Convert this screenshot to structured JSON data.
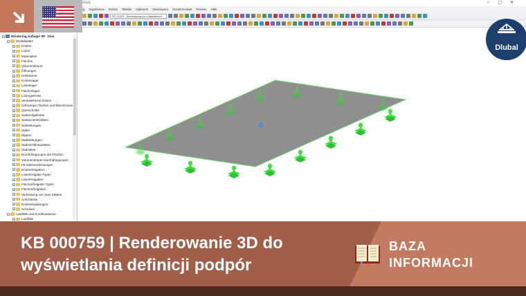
{
  "window": {
    "title": "Glas]"
  },
  "menu": [
    "ung",
    "Ergebnisse",
    "Extras",
    "Tabelle",
    "Optionen",
    "Developers",
    "Zusatzmodule",
    "Fenster",
    "Hilfe"
  ],
  "toolbar": {
    "module_combo": "RF-GLAS - Bemessung von Glasflächen"
  },
  "tree": {
    "root": "Rendering Auflager RF_Glas",
    "items": [
      {
        "label": "Modelldaten",
        "level": 1
      },
      {
        "label": "Knoten",
        "level": 2
      },
      {
        "label": "Linien",
        "level": 2
      },
      {
        "label": "Materialien",
        "level": 2
      },
      {
        "label": "Flächen",
        "level": 2
      },
      {
        "label": "Volumenkörper",
        "level": 2
      },
      {
        "label": "Öffnungen",
        "level": 2
      },
      {
        "label": "Hohlräume",
        "level": 2
      },
      {
        "label": "Knotenlager",
        "level": 2
      },
      {
        "label": "Linienlager",
        "level": 2
      },
      {
        "label": "Flächenlager",
        "level": 2
      },
      {
        "label": "Liniengelenke",
        "level": 2
      },
      {
        "label": "Veränderliche Dicken",
        "level": 2
      },
      {
        "label": "Orthotrope Flächen und Membranen",
        "level": 2
      },
      {
        "label": "Querschnitte",
        "level": 2
      },
      {
        "label": "Stabendgelenke",
        "level": 2
      },
      {
        "label": "Stabexzentrizitäten",
        "level": 2
      },
      {
        "label": "Stabteilungen",
        "level": 2
      },
      {
        "label": "Stäbe",
        "level": 2
      },
      {
        "label": "Rippen",
        "level": 2
      },
      {
        "label": "Stabbettungen",
        "level": 2
      },
      {
        "label": "Stabnichtlinearitäten",
        "level": 2
      },
      {
        "label": "Stabsätze",
        "level": 2
      },
      {
        "label": "Durchdringungen der Flächen",
        "level": 2
      },
      {
        "label": "Volumenkörper-Durchdringungen",
        "level": 2
      },
      {
        "label": "FE-Netzverdichtungen",
        "level": 2
      },
      {
        "label": "Knotenfreigaben",
        "level": 2
      },
      {
        "label": "Linienfreigabe-Typen",
        "level": 2
      },
      {
        "label": "Linienfreigaben",
        "level": 2
      },
      {
        "label": "Flächenfreigabe-Typen",
        "level": 2
      },
      {
        "label": "Flächenfreigaben",
        "level": 2
      },
      {
        "label": "Verbindung von zwei Stäben",
        "level": 2
      },
      {
        "label": "Anschlüsse",
        "level": 2
      },
      {
        "label": "Knotenkopplungen",
        "level": 2
      },
      {
        "label": "Scheiben",
        "level": 2
      },
      {
        "label": "Lastfälle und Kombinationen",
        "level": 1
      },
      {
        "label": "Lastfälle",
        "level": 2
      }
    ]
  },
  "logo": {
    "text": "Dlubal"
  },
  "banner": {
    "title": "KB 000759 | Renderowanie 3D do wyświetlania definicji podpór",
    "category_line1": "BAZA",
    "category_line2": "INFORMACJI"
  },
  "colors": {
    "accent": "#c27a60",
    "accent_dark": "#a15e48",
    "footer": "#4d2a20",
    "support": "#3ee03e",
    "plate": "#8f8f8f"
  }
}
